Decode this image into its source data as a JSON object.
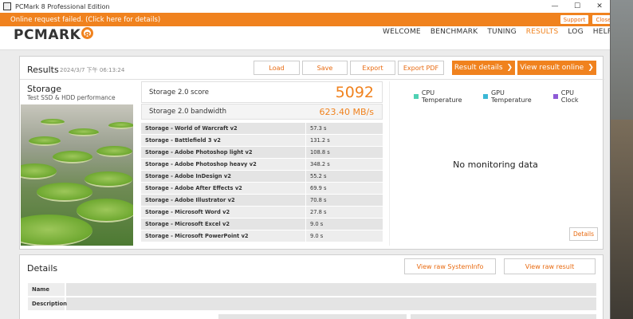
{
  "window": {
    "title": "PCMark 8 Professional Edition",
    "minimize": "—",
    "maximize": "☐",
    "close": "✕"
  },
  "notice": {
    "text": "Online request failed.  (Click here for details)",
    "support": "Support",
    "close": "Close"
  },
  "app": {
    "logo_text": "PCMARK",
    "logo_badge": "8",
    "nav": [
      {
        "label": "WELCOME"
      },
      {
        "label": "BENCHMARK"
      },
      {
        "label": "TUNING"
      },
      {
        "label": "RESULTS",
        "active": true
      },
      {
        "label": "LOG"
      },
      {
        "label": "HELP"
      }
    ]
  },
  "results": {
    "title": "Results",
    "date": "2024/3/7 下午 06:13:24",
    "buttons": {
      "load": "Load",
      "save": "Save",
      "export": "Export",
      "export_pdf": "Export PDF",
      "result_details": "Result details",
      "view_online": "View result online",
      "chevron": "❯"
    },
    "benchmark": {
      "name": "Storage",
      "description": "Test SSD & HDD performance"
    },
    "score": {
      "label": "Storage 2.0 score",
      "value": "5092"
    },
    "bandwidth": {
      "label": "Storage 2.0 bandwidth",
      "value": "623.40 MB/s"
    },
    "subtests": [
      {
        "name": "Storage - World of Warcraft v2",
        "value": "57.3 s"
      },
      {
        "name": "Storage - Battlefield 3 v2",
        "value": "131.2 s"
      },
      {
        "name": "Storage - Adobe Photoshop light v2",
        "value": "108.8 s"
      },
      {
        "name": "Storage - Adobe Photoshop heavy v2",
        "value": "348.2 s"
      },
      {
        "name": "Storage - Adobe InDesign v2",
        "value": "55.2 s"
      },
      {
        "name": "Storage - Adobe After Effects v2",
        "value": "69.9 s"
      },
      {
        "name": "Storage - Adobe Illustrator v2",
        "value": "70.8 s"
      },
      {
        "name": "Storage - Microsoft Word v2",
        "value": "27.8 s"
      },
      {
        "name": "Storage - Microsoft Excel v2",
        "value": "9.0 s"
      },
      {
        "name": "Storage - Microsoft PowerPoint v2",
        "value": "9.0 s"
      }
    ],
    "monitor": {
      "legend": [
        {
          "label": "CPU Temperature",
          "color": "#4fd1b3"
        },
        {
          "label": "GPU Temperature",
          "color": "#3bb8d6"
        },
        {
          "label": "CPU Clock",
          "color": "#8e5ad6"
        }
      ],
      "no_data": "No monitoring data",
      "details": "Details"
    }
  },
  "details": {
    "title": "Details",
    "view_sysinfo": "View raw SystemInfo",
    "view_result": "View raw result",
    "fields": [
      {
        "label": "Name"
      },
      {
        "label": "Description"
      }
    ]
  },
  "colors": {
    "accent": "#f0821e"
  }
}
